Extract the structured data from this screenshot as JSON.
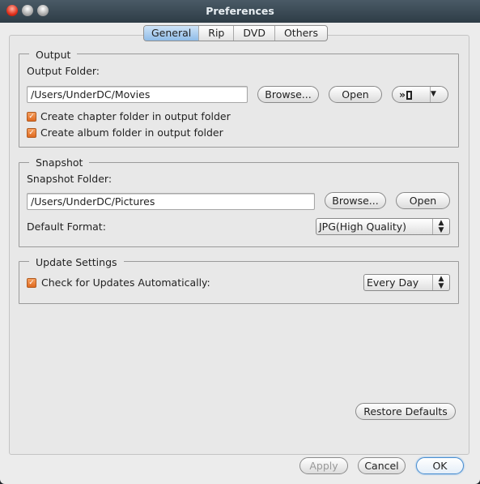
{
  "window": {
    "title": "Preferences"
  },
  "tabs": [
    {
      "label": "General",
      "selected": true
    },
    {
      "label": "Rip"
    },
    {
      "label": "DVD"
    },
    {
      "label": "Others"
    }
  ],
  "output": {
    "legend": "Output",
    "folder_label": "Output Folder:",
    "folder_value": "/Users/UnderDC/Movies",
    "browse": "Browse...",
    "open": "Open",
    "device_icon": "ipod-forward-icon",
    "chapter_checkbox": {
      "label": "Create chapter folder in output folder",
      "checked": true
    },
    "album_checkbox": {
      "label": "Create album folder in output folder",
      "checked": true
    }
  },
  "snapshot": {
    "legend": "Snapshot",
    "folder_label": "Snapshot Folder:",
    "folder_value": "/Users/UnderDC/Pictures",
    "browse": "Browse...",
    "open": "Open",
    "format_label": "Default Format:",
    "format_value": "JPG(High Quality)"
  },
  "update": {
    "legend": "Update Settings",
    "check_label": "Check for Updates Automatically:",
    "checked": true,
    "frequency": "Every Day"
  },
  "buttons": {
    "restore": "Restore Defaults",
    "apply": "Apply",
    "cancel": "Cancel",
    "ok": "OK"
  },
  "colors": {
    "accent": "#8fbce8",
    "checkbox": "#e06a20"
  }
}
